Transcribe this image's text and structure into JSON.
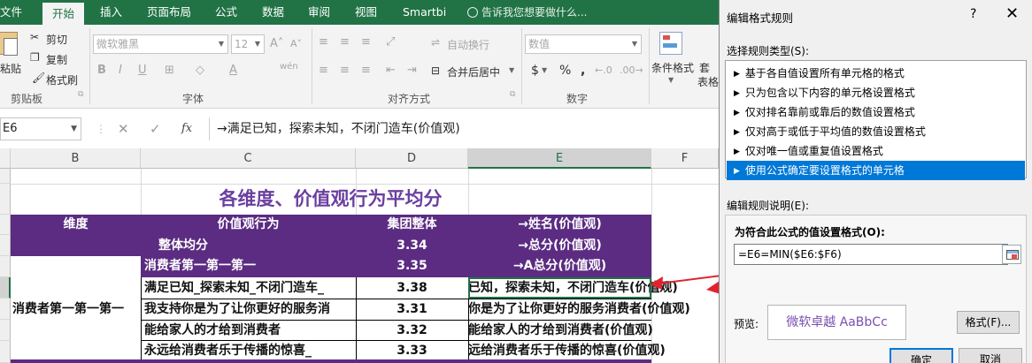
{
  "ribbon_tabs": [
    {
      "label": "文件"
    },
    {
      "label": "开始"
    },
    {
      "label": "插入"
    },
    {
      "label": "页面布局"
    },
    {
      "label": "公式"
    },
    {
      "label": "数据"
    },
    {
      "label": "审阅"
    },
    {
      "label": "视图"
    },
    {
      "label": "Smartbi"
    }
  ],
  "active_tab": "开始",
  "tell_me": "告诉我您想要做什么...",
  "ribbon": {
    "paste_label": "粘贴",
    "cut_label": "剪切",
    "copy_label": "复制",
    "format_painter_label": "格式刷",
    "clipboard_group": "剪贴板",
    "font_name": "微软雅黑",
    "font_size": "12",
    "font_group": "字体",
    "wrap_text_label": "自动换行",
    "merge_center_label": "合并后居中",
    "alignment_group": "对齐方式",
    "number_format": "数值",
    "number_group": "数字",
    "conditional_format_label": "条件格式",
    "table_label_partial": "表格"
  },
  "formula_bar": {
    "name_box": "E6",
    "formula": "→满足已知，探索未知，不闭门造车(价值观)"
  },
  "sheet": {
    "columns": [
      "B",
      "C",
      "D",
      "E",
      "F"
    ],
    "selected_column": "E",
    "title": "各维度、价值观行为平均分",
    "header": {
      "dimension": "维度",
      "behavior": "价值观行为",
      "group_total": "集团整体",
      "name_col": "→姓名(价值观)"
    },
    "overall": {
      "label": "整体均分",
      "value": "3.34",
      "e": "→总分(价值观)"
    },
    "sub_header": {
      "behavior": "消费者第一第一第一",
      "value": "3.35",
      "e": "→A总分(价值观)"
    },
    "group_name": "消费者第一第一第一",
    "rows": [
      {
        "behavior": "满足已知_探索未知_不闭门造车_",
        "value": "3.38",
        "e": "已知，探索未知，不闭门造车(价值观)"
      },
      {
        "behavior": "我支持你是为了让你更好的服务消",
        "value": "3.31",
        "e": "你是为了让你更好的服务消费者(价值观)"
      },
      {
        "behavior": "能给家人的才给到消费者",
        "value": "3.32",
        "e": "能给家人的才给到消费者(价值观)"
      },
      {
        "behavior": "永远给消费者乐于传播的惊喜_",
        "value": "3.33",
        "e": "远给消费者乐于传播的惊喜(价值观)"
      }
    ]
  },
  "dialog": {
    "title": "编辑格式规则",
    "help": "?",
    "close": "✕",
    "select_type_label": "选择规则类型(S):",
    "rule_types": [
      "基于各自值设置所有单元格的格式",
      "只为包含以下内容的单元格设置格式",
      "仅对排名靠前或靠后的数值设置格式",
      "仅对高于或低于平均值的数值设置格式",
      "仅对唯一值或重复值设置格式",
      "使用公式确定要设置格式的单元格"
    ],
    "selected_rule_index": 5,
    "edit_desc_label": "编辑规则说明(E):",
    "formula_label": "为符合此公式的值设置格式(O):",
    "formula_value": "=E6=MIN($E6:$F6)",
    "preview_label": "预览:",
    "preview_text": "微软卓越  AaBbCc",
    "format_button": "格式(F)...",
    "ok_button": "确定",
    "cancel_button": "取消"
  },
  "colors": {
    "excel_green": "#217346",
    "purple_band": "#5b2c82",
    "title_purple": "#6b3fa0",
    "selection_blue": "#0078d7",
    "arrow_red": "#e0242f"
  }
}
